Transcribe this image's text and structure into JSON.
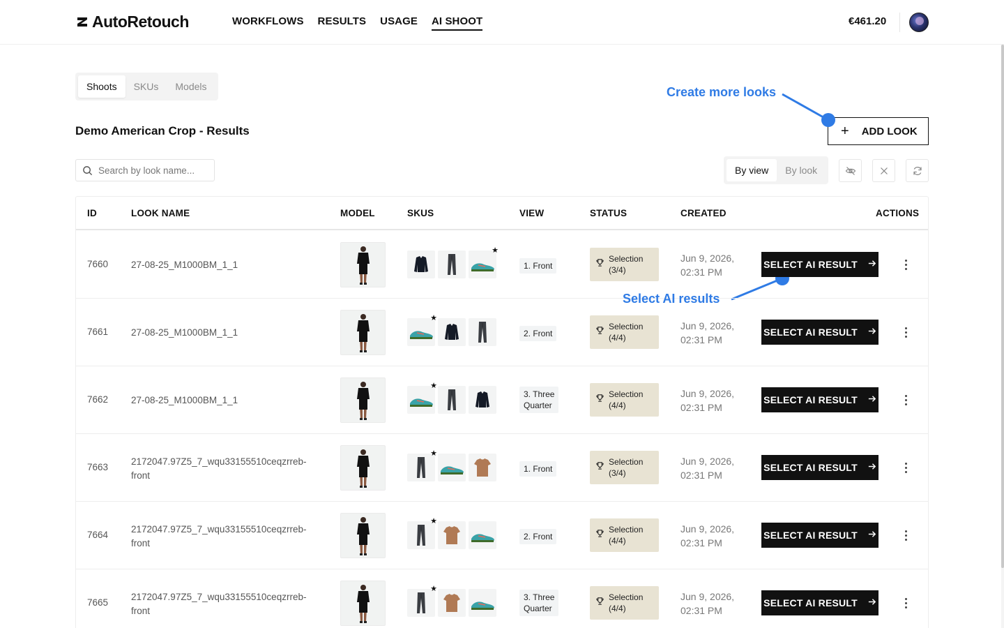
{
  "header": {
    "logo_text": "AutoRetouch",
    "nav": [
      "WORKFLOWS",
      "RESULTS",
      "USAGE",
      "AI SHOOT"
    ],
    "active_nav": "AI SHOOT",
    "balance": "€461.20"
  },
  "tabs": [
    "Shoots",
    "SKUs",
    "Models"
  ],
  "active_tab": "Shoots",
  "page_title": "Demo American Crop - Results",
  "add_look_label": "ADD LOOK",
  "annotations": {
    "create_more_looks": "Create more looks",
    "select_ai_results": "Select AI results"
  },
  "search": {
    "placeholder": "Search by look name..."
  },
  "view_toggle": [
    "By view",
    "By look"
  ],
  "active_view": "By view",
  "columns": [
    "ID",
    "LOOK NAME",
    "MODEL",
    "SKUS",
    "VIEW",
    "STATUS",
    "CREATED",
    "ACTIONS"
  ],
  "action_label": "SELECT AI RESULT",
  "rows": [
    {
      "id": "7660",
      "name_line1": "27-08-25_M1000BM_1_1",
      "name_line2": "",
      "view_line1": "1. Front",
      "view_line2": "",
      "status_line1": "Selection",
      "status_line2": "(3/4)",
      "created_line1": "Jun 9, 2026,",
      "created_line2": "02:31 PM",
      "skus": [
        "jacket",
        "pants",
        "shoe"
      ],
      "star_index": 2
    },
    {
      "id": "7661",
      "name_line1": "27-08-25_M1000BM_1_1",
      "name_line2": "",
      "view_line1": "2. Front",
      "view_line2": "",
      "status_line1": "Selection",
      "status_line2": "(4/4)",
      "created_line1": "Jun 9, 2026,",
      "created_line2": "02:31 PM",
      "skus": [
        "shoe",
        "jacket",
        "pants"
      ],
      "star_index": 0
    },
    {
      "id": "7662",
      "name_line1": "27-08-25_M1000BM_1_1",
      "name_line2": "",
      "view_line1": "3. Three",
      "view_line2": "Quarter",
      "status_line1": "Selection",
      "status_line2": "(4/4)",
      "created_line1": "Jun 9, 2026,",
      "created_line2": "02:31 PM",
      "skus": [
        "shoe",
        "pants",
        "jacket"
      ],
      "star_index": 0
    },
    {
      "id": "7663",
      "name_line1": "2172047.97Z5_7_wqu33155510ceqzrreb-",
      "name_line2": "front",
      "view_line1": "1. Front",
      "view_line2": "",
      "status_line1": "Selection",
      "status_line2": "(3/4)",
      "created_line1": "Jun 9, 2026,",
      "created_line2": "02:31 PM",
      "skus": [
        "pants",
        "shoe",
        "tshirt"
      ],
      "star_index": 0
    },
    {
      "id": "7664",
      "name_line1": "2172047.97Z5_7_wqu33155510ceqzrreb-",
      "name_line2": "front",
      "view_line1": "2. Front",
      "view_line2": "",
      "status_line1": "Selection",
      "status_line2": "(4/4)",
      "created_line1": "Jun 9, 2026,",
      "created_line2": "02:31 PM",
      "skus": [
        "pants",
        "tshirt",
        "shoe"
      ],
      "star_index": 0
    },
    {
      "id": "7665",
      "name_line1": "2172047.97Z5_7_wqu33155510ceqzrreb-",
      "name_line2": "front",
      "view_line1": "3. Three",
      "view_line2": "Quarter",
      "status_line1": "Selection",
      "status_line2": "(4/4)",
      "created_line1": "Jun 9, 2026,",
      "created_line2": "02:31 PM",
      "skus": [
        "pants",
        "tshirt",
        "shoe"
      ],
      "star_index": 0
    }
  ],
  "colors": {
    "accent": "#2f7be5",
    "status_bg": "#e8e3d3",
    "button": "#111111"
  }
}
